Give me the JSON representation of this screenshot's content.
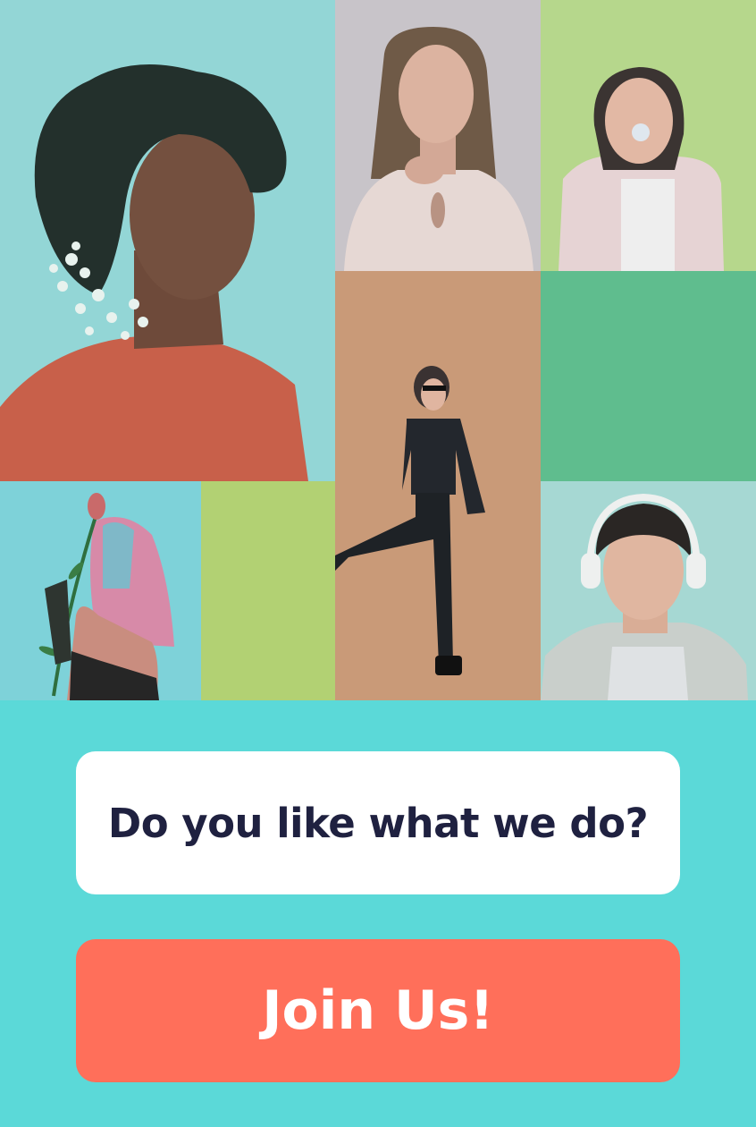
{
  "cta": {
    "question": "Do you like what we do?",
    "button_label": "Join Us!"
  },
  "colors": {
    "background": "#5bd9d8",
    "card": "#ffffff",
    "question_text": "#1f2140",
    "button": "#ff6f5a",
    "button_text": "#ffffff"
  },
  "tiles": [
    {
      "name": "curly-hair-woman-photo"
    },
    {
      "name": "long-hair-woman-photo"
    },
    {
      "name": "bubblegum-girl-photo"
    },
    {
      "name": "sunglasses-woman-photo"
    },
    {
      "name": "green-color-block"
    },
    {
      "name": "pink-blue-hair-woman-photo"
    },
    {
      "name": "lime-color-block"
    },
    {
      "name": "headphones-boy-photo"
    }
  ]
}
